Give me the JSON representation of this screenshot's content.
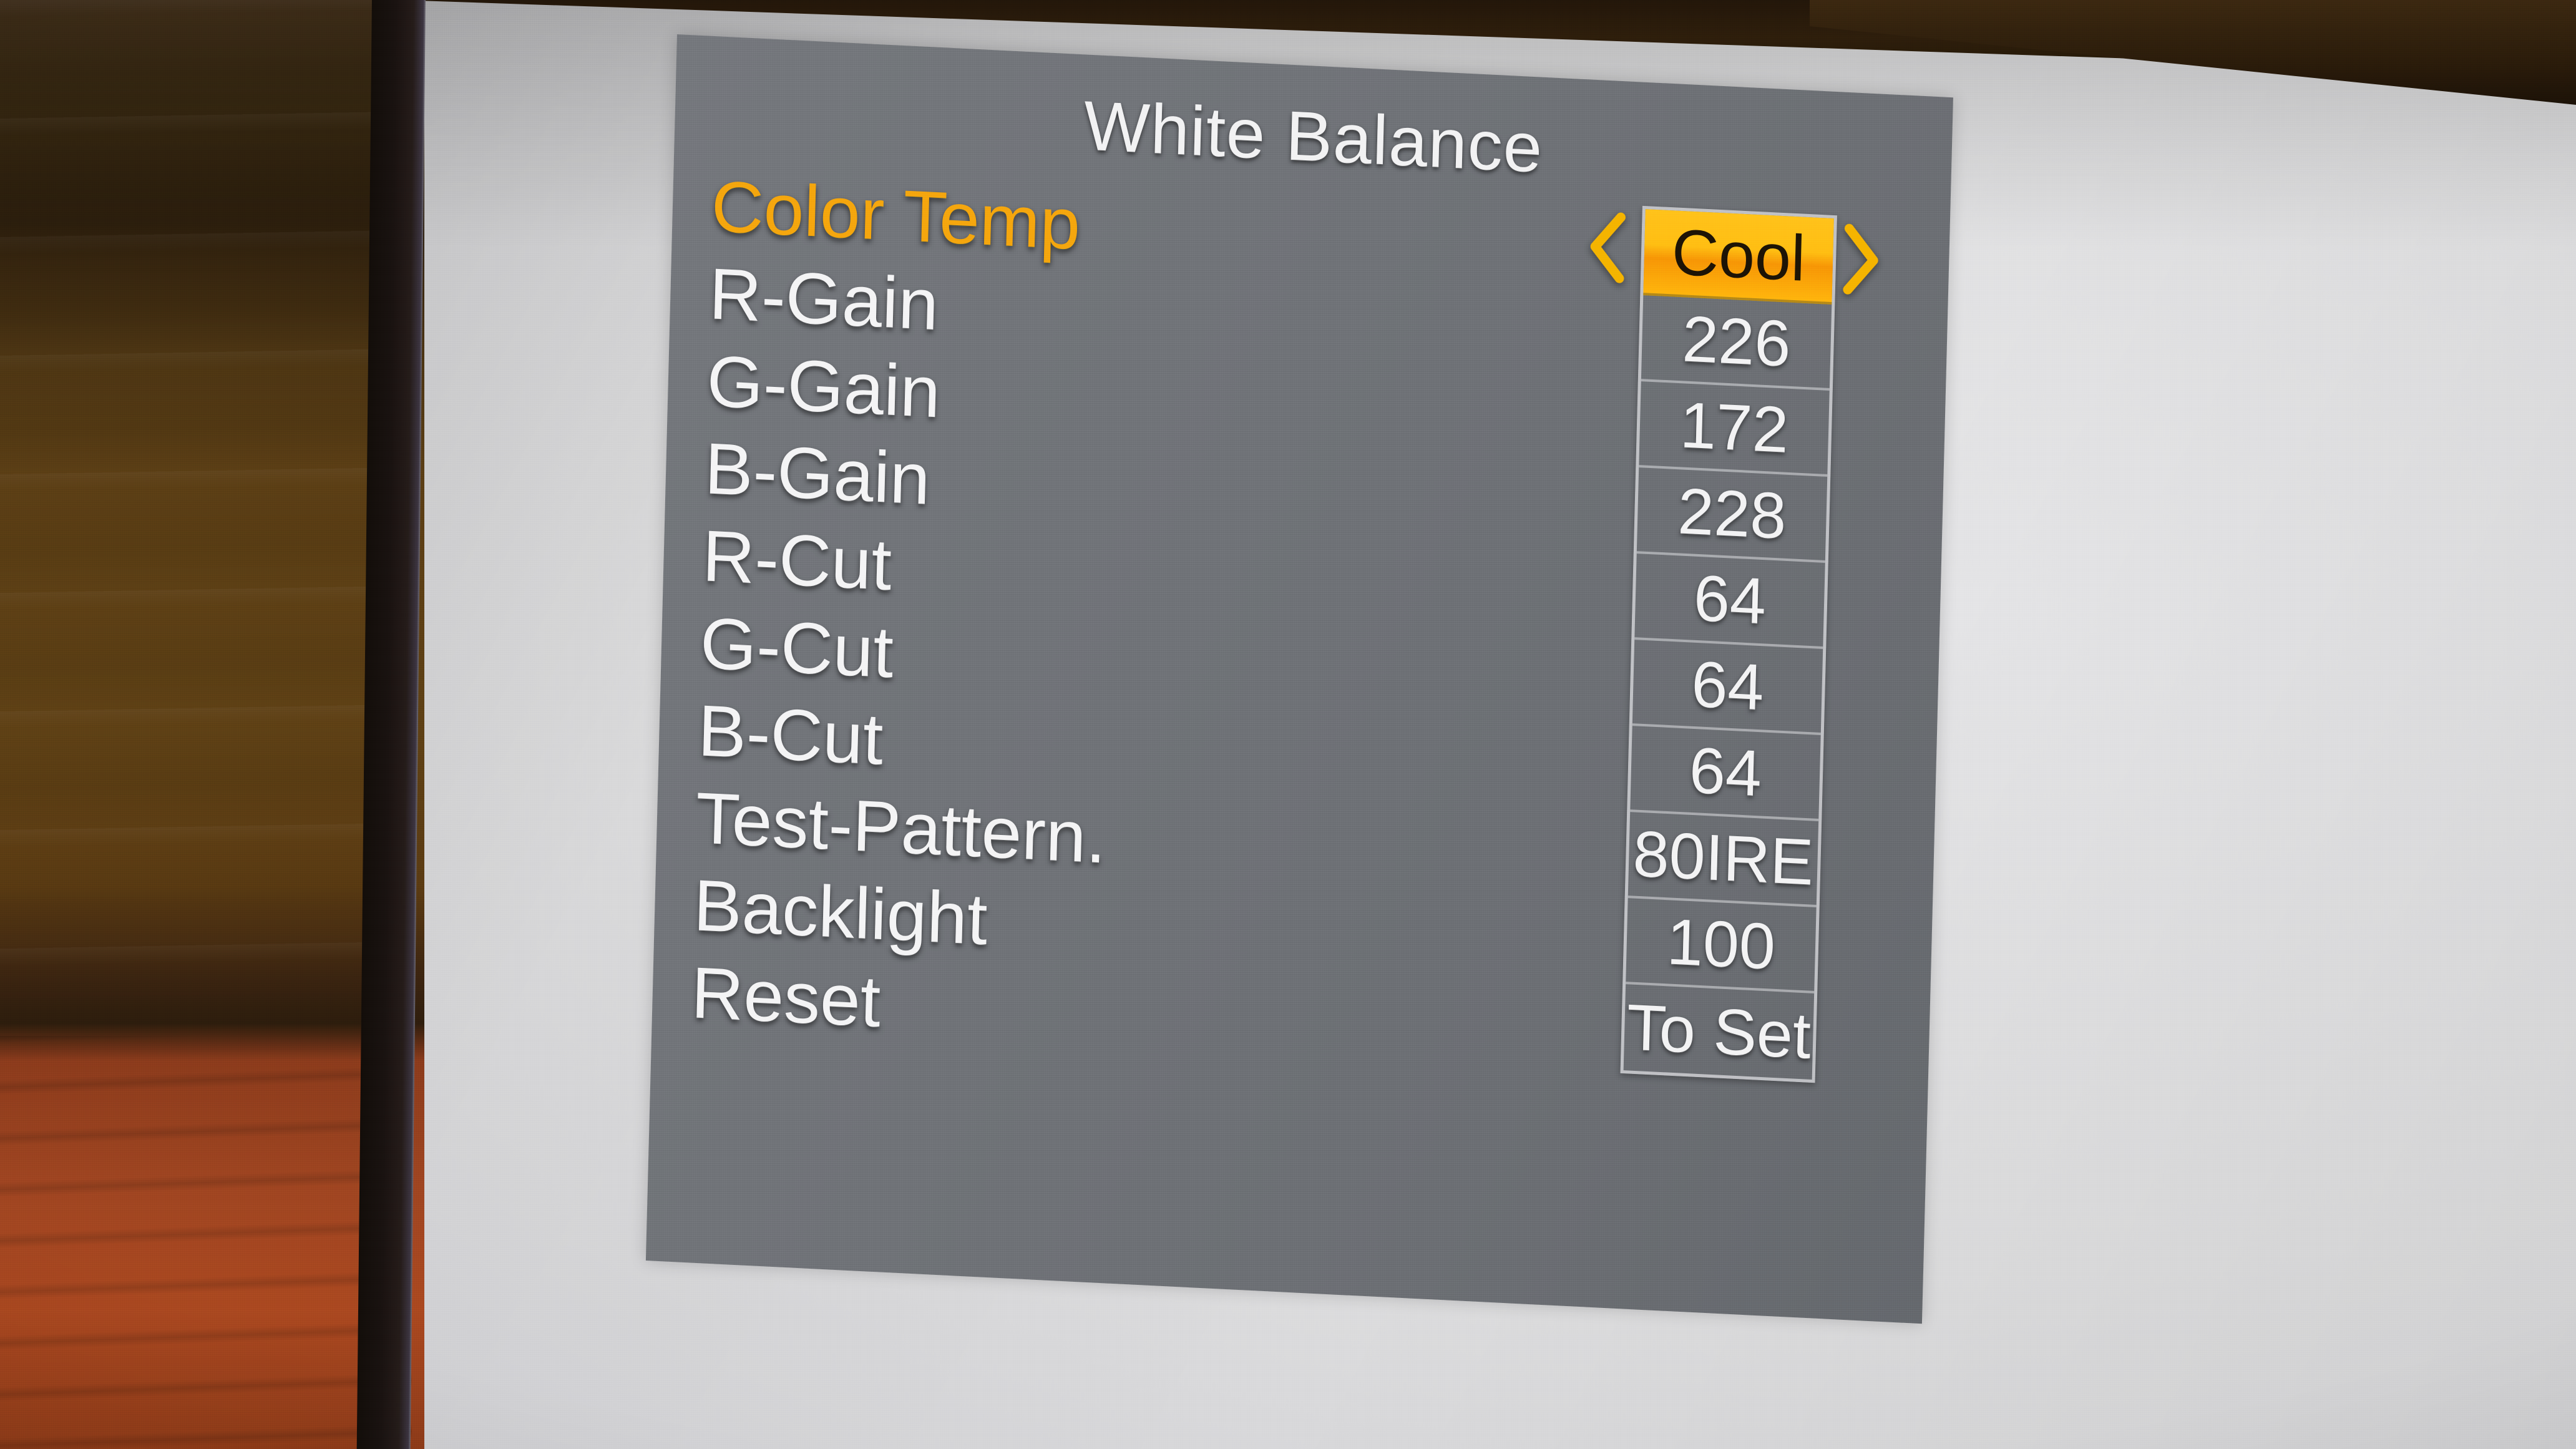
{
  "osd": {
    "title": "White Balance",
    "selected_row_index": 0,
    "panel_color": "#6e7176",
    "label_color": "#f4f4f5",
    "highlight_color": "#ffbd12",
    "selected_label_color": "#f5a50d",
    "rows": [
      {
        "label": "Color Temp",
        "value": "Cool",
        "selected": true
      },
      {
        "label": "R-Gain",
        "value": "226",
        "selected": false
      },
      {
        "label": "G-Gain",
        "value": "172",
        "selected": false
      },
      {
        "label": "B-Gain",
        "value": "228",
        "selected": false
      },
      {
        "label": "R-Cut",
        "value": "64",
        "selected": false
      },
      {
        "label": "G-Cut",
        "value": "64",
        "selected": false
      },
      {
        "label": "B-Cut",
        "value": "64",
        "selected": false
      },
      {
        "label": "Test-Pattern.",
        "value": "80IRE",
        "selected": false
      },
      {
        "label": "Backlight",
        "value": "100",
        "selected": false
      },
      {
        "label": "Reset",
        "value": "To Set",
        "selected": false
      }
    ],
    "nav": {
      "prev_icon": "chevron-left-icon",
      "next_icon": "chevron-right-icon",
      "arrow_color": "#f5b300"
    }
  },
  "scene": {
    "screen_color": "#d8d8db",
    "bezel_color": "#191210",
    "wall_wood_color": "#5a3d14",
    "wall_panel_color": "#a9471f"
  }
}
